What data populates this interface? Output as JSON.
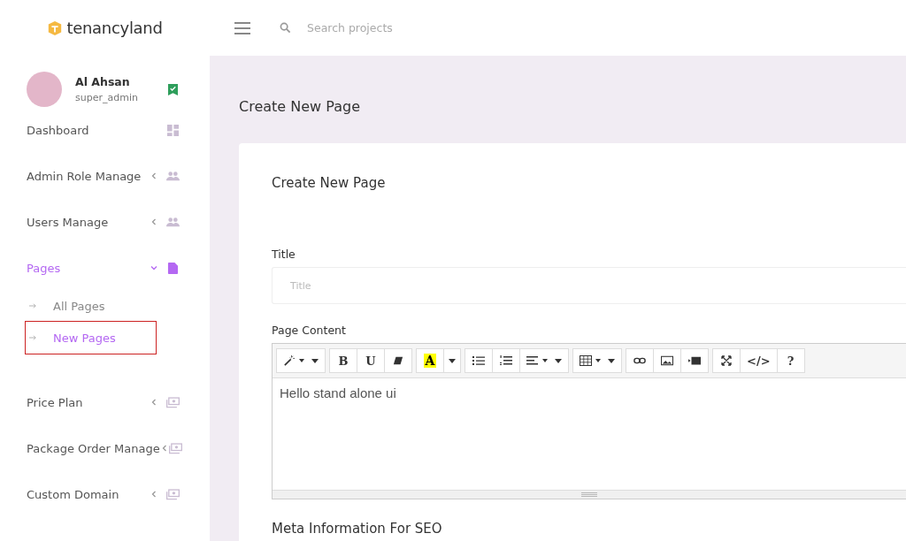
{
  "brand": {
    "name": "tenancyland"
  },
  "search": {
    "placeholder": "Search projects"
  },
  "user": {
    "name": "Al Ahsan",
    "role": "super_admin",
    "verified": true
  },
  "nav": [
    {
      "label": "Dashboard",
      "kind": "dashboard",
      "selected": false
    },
    {
      "label": "Admin Role Manage",
      "kind": "people",
      "selected": false,
      "expanded": false
    },
    {
      "label": "Users Manage",
      "kind": "people",
      "selected": false,
      "expanded": false
    },
    {
      "label": "Pages",
      "kind": "page",
      "selected": true,
      "expanded": true,
      "children": [
        {
          "label": "All Pages",
          "selected": false
        },
        {
          "label": "New Pages",
          "selected": true
        }
      ]
    },
    {
      "label": "Price Plan",
      "kind": "money",
      "selected": false,
      "expanded": false
    },
    {
      "label": "Package Order Manage",
      "kind": "money",
      "selected": false,
      "expanded": false
    },
    {
      "label": "Custom Domain",
      "kind": "money",
      "selected": false,
      "expanded": false
    }
  ],
  "page_title": "Create New Page",
  "card": {
    "title": "Create New Page",
    "title_field": {
      "label": "Title",
      "placeholder": "Title"
    },
    "content_label": "Page Content",
    "toolbar": [
      [
        {
          "kind": "magic",
          "dropdown": true
        }
      ],
      [
        {
          "kind": "text",
          "label": "B"
        },
        {
          "kind": "text",
          "label": "U"
        },
        {
          "kind": "eraser"
        }
      ],
      [
        {
          "kind": "highlight",
          "label": "A"
        },
        {
          "kind": "caret"
        }
      ],
      [
        {
          "kind": "bullets"
        },
        {
          "kind": "numbers"
        },
        {
          "kind": "align",
          "dropdown": true
        }
      ],
      [
        {
          "kind": "table",
          "dropdown": true
        }
      ],
      [
        {
          "kind": "link"
        },
        {
          "kind": "image"
        },
        {
          "kind": "video"
        }
      ],
      [
        {
          "kind": "expand"
        },
        {
          "kind": "text",
          "label": "</>"
        },
        {
          "kind": "text",
          "label": "?"
        }
      ]
    ],
    "content": "Hello stand alone ui",
    "section_title": "Meta Information For SEO"
  }
}
